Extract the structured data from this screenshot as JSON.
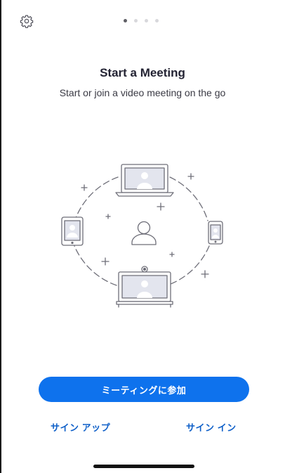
{
  "header": {
    "settings_icon": "gear-icon",
    "pager": {
      "total": 4,
      "active_index": 0
    }
  },
  "onboarding": {
    "title": "Start a Meeting",
    "subtitle": "Start or join a video meeting on the go",
    "illustration_icon": "video-meeting-devices-illustration"
  },
  "actions": {
    "join_meeting_label": "ミーティングに参加",
    "sign_up_label": "サイン アップ",
    "sign_in_label": "サイン イン"
  },
  "colors": {
    "primary": "#0e72ed",
    "link": "#0e5fc8",
    "text": "#232333",
    "illustration_stroke": "#6e6e78",
    "illustration_fill": "#e3e5ee"
  }
}
